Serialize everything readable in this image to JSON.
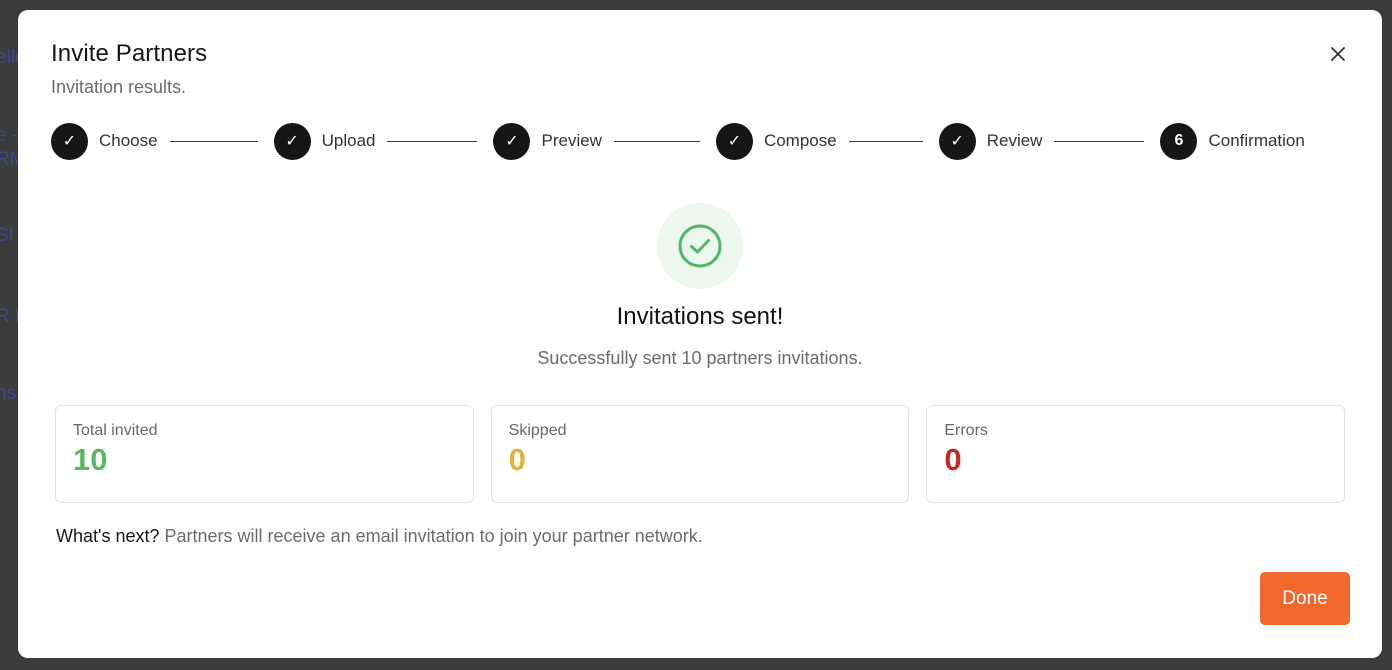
{
  "background": {
    "peek_lines": [
      "elle",
      "e -",
      "RM",
      "SI",
      "R F",
      "ns"
    ]
  },
  "modal": {
    "title": "Invite Partners",
    "subtitle": "Invitation results.",
    "close_icon": "close-icon"
  },
  "stepper": {
    "steps": [
      {
        "label": "Choose",
        "marker": "✓",
        "state": "complete"
      },
      {
        "label": "Upload",
        "marker": "✓",
        "state": "complete"
      },
      {
        "label": "Preview",
        "marker": "✓",
        "state": "complete"
      },
      {
        "label": "Compose",
        "marker": "✓",
        "state": "complete"
      },
      {
        "label": "Review",
        "marker": "✓",
        "state": "complete"
      },
      {
        "label": "Confirmation",
        "marker": "6",
        "state": "current"
      }
    ]
  },
  "result": {
    "icon": "check-circle-icon",
    "heading": "Invitations sent!",
    "message": "Successfully sent 10 partners invitations."
  },
  "stats": [
    {
      "label": "Total invited",
      "value": "10",
      "color": "#5cb85c"
    },
    {
      "label": "Skipped",
      "value": "0",
      "color": "#e0b433"
    },
    {
      "label": "Errors",
      "value": "0",
      "color": "#c62828"
    }
  ],
  "next": {
    "label": "What's next?",
    "text": "Partners will receive an email invitation to join your partner network."
  },
  "footer": {
    "done_label": "Done",
    "done_color": "#f0682e"
  }
}
